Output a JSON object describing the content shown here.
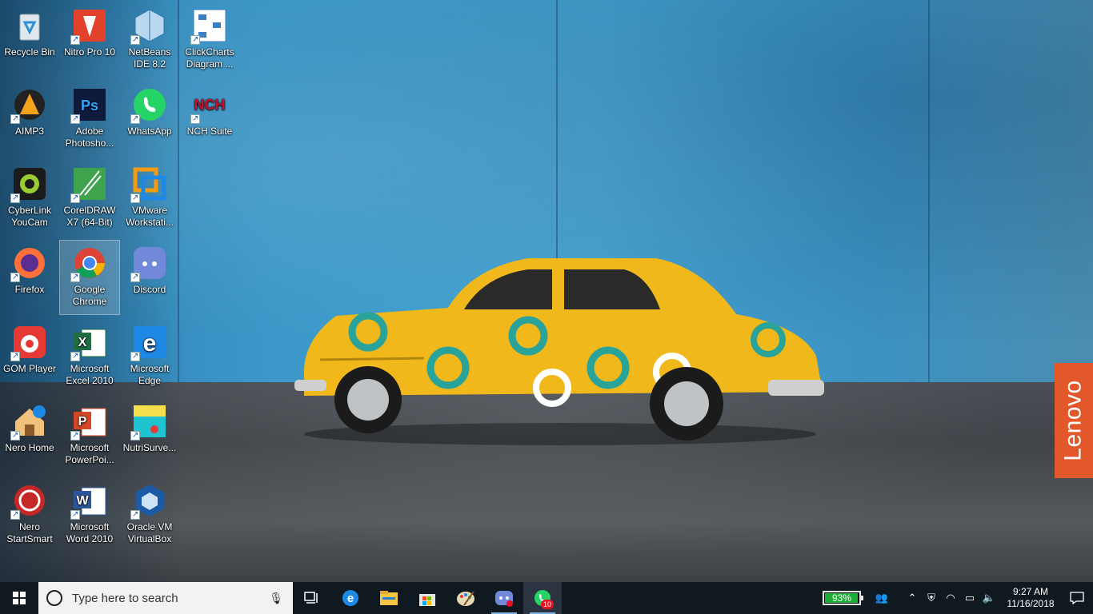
{
  "desktop": {
    "icons": [
      {
        "label": "Recycle Bin",
        "icon": "recycle-bin-icon"
      },
      {
        "label": "Nitro Pro 10",
        "icon": "nitro-pro-icon"
      },
      {
        "label": "NetBeans IDE 8.2",
        "icon": "netbeans-icon"
      },
      {
        "label": "ClickCharts Diagram ...",
        "icon": "clickcharts-icon"
      },
      {
        "label": "AIMP3",
        "icon": "aimp-icon"
      },
      {
        "label": "Adobe Photosho...",
        "icon": "photoshop-icon"
      },
      {
        "label": "WhatsApp",
        "icon": "whatsapp-icon"
      },
      {
        "label": "NCH Suite",
        "icon": "nch-suite-icon"
      },
      {
        "label": "CyberLink YouCam",
        "icon": "youcam-icon"
      },
      {
        "label": "CorelDRAW X7 (64-Bit)",
        "icon": "coreldraw-icon"
      },
      {
        "label": "VMware Workstati...",
        "icon": "vmware-icon"
      },
      {
        "label": "Firefox",
        "icon": "firefox-icon"
      },
      {
        "label": "Google Chrome",
        "icon": "chrome-icon"
      },
      {
        "label": "Discord",
        "icon": "discord-icon"
      },
      {
        "label": "GOM Player",
        "icon": "gom-player-icon"
      },
      {
        "label": "Microsoft Excel 2010",
        "icon": "excel-icon"
      },
      {
        "label": "Microsoft Edge",
        "icon": "edge-icon"
      },
      {
        "label": "Nero Home",
        "icon": "nero-home-icon"
      },
      {
        "label": "Microsoft PowerPoi...",
        "icon": "powerpoint-icon"
      },
      {
        "label": "NutriSurve...",
        "icon": "nutrisurvey-icon"
      },
      {
        "label": "Nero StartSmart",
        "icon": "nero-startsmart-icon"
      },
      {
        "label": "Microsoft Word 2010",
        "icon": "word-icon"
      },
      {
        "label": "Oracle VM VirtualBox",
        "icon": "virtualbox-icon"
      }
    ],
    "wallpaper_brand": "Lenovo"
  },
  "taskbar": {
    "search_placeholder": "Type here to search",
    "pinned": [
      "task-view-icon",
      "edge-icon",
      "file-explorer-icon",
      "store-icon",
      "paint-icon",
      "discord-icon",
      "whatsapp-icon"
    ],
    "whatsapp_badge": "10",
    "battery_percent": "93%",
    "battery_level": 0.93,
    "time": "9:27 AM",
    "date": "11/16/2018"
  },
  "colors": {
    "accent": "#0078d7",
    "taskbar": "#101820",
    "lenovo": "#e2582a",
    "battery": "#1fae3a"
  }
}
